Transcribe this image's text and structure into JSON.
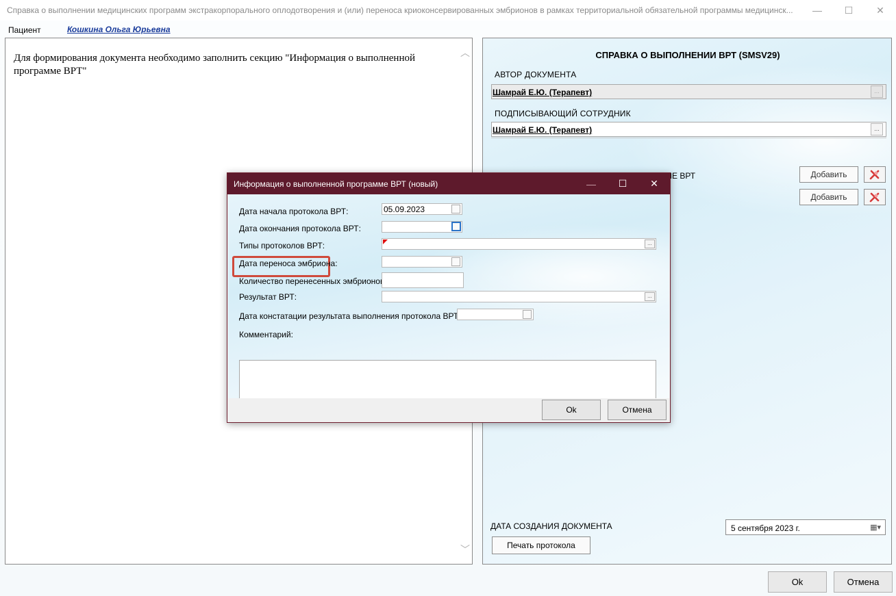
{
  "window": {
    "title": "Справка о выполнении медицинских программ экстракорпорального оплодотворения и (или) переноса криоконсервированных эмбрионов в рамках территориальной обязательной программы медицинск...",
    "minimize": "—",
    "maximize": "☐",
    "close": "✕"
  },
  "patient": {
    "label": "Пациент",
    "name": "Кошкина Ольга Юрьевна"
  },
  "left_panel": {
    "message": "Для формирования документа необходимо заполнить секцию \"Информация о выполненной программе ВРТ\""
  },
  "right_panel": {
    "title": "СПРАВКА О ВЫПОЛНЕНИИ ВРТ (SMSV29)",
    "author_label": "АВТОР ДОКУМЕНТА",
    "author_value": "Шамрай Е.Ю. (Терапевт)",
    "signer_label": "ПОДПИСЫВАЮЩИЙ СОТРУДНИК",
    "signer_value": "Шамрай Е.Ю. (Терапевт)",
    "ellipsis": "...",
    "section_partial": "МЕ ВРТ",
    "add_label": "Добавить",
    "date_label": "ДАТА СОЗДАНИЯ ДОКУМЕНТА",
    "date_value": "5 сентября 2023 г.",
    "print_label": "Печать протокола"
  },
  "main_buttons": {
    "ok": "Ok",
    "cancel": "Отмена"
  },
  "dialog": {
    "title": "Информация о выполненной программе ВРТ (новый)",
    "fields": {
      "start_date_label": "Дата начала протокола ВРТ:",
      "start_date_value": "05.09.2023",
      "end_date_label": "Дата окончания протокола ВРТ:",
      "types_label": "Типы протоколов ВРТ:",
      "transfer_date_label": "Дата переноса эмбриона:",
      "embryo_count_label": "Количество перенесенных эмбрионов:",
      "result_label": "Результат ВРТ:",
      "result_date_label": "Дата констатации результата выполнения протокола ВРТ:",
      "comment_label": "Комментарий:"
    },
    "ellipsis": "...",
    "ok": "Ok",
    "cancel": "Отмена"
  },
  "colors": {
    "dialog_titlebar": "#5e1a2c",
    "highlight": "#cf4a3c",
    "patient_link": "#1a3c9b",
    "required_flag": "#e01010"
  }
}
